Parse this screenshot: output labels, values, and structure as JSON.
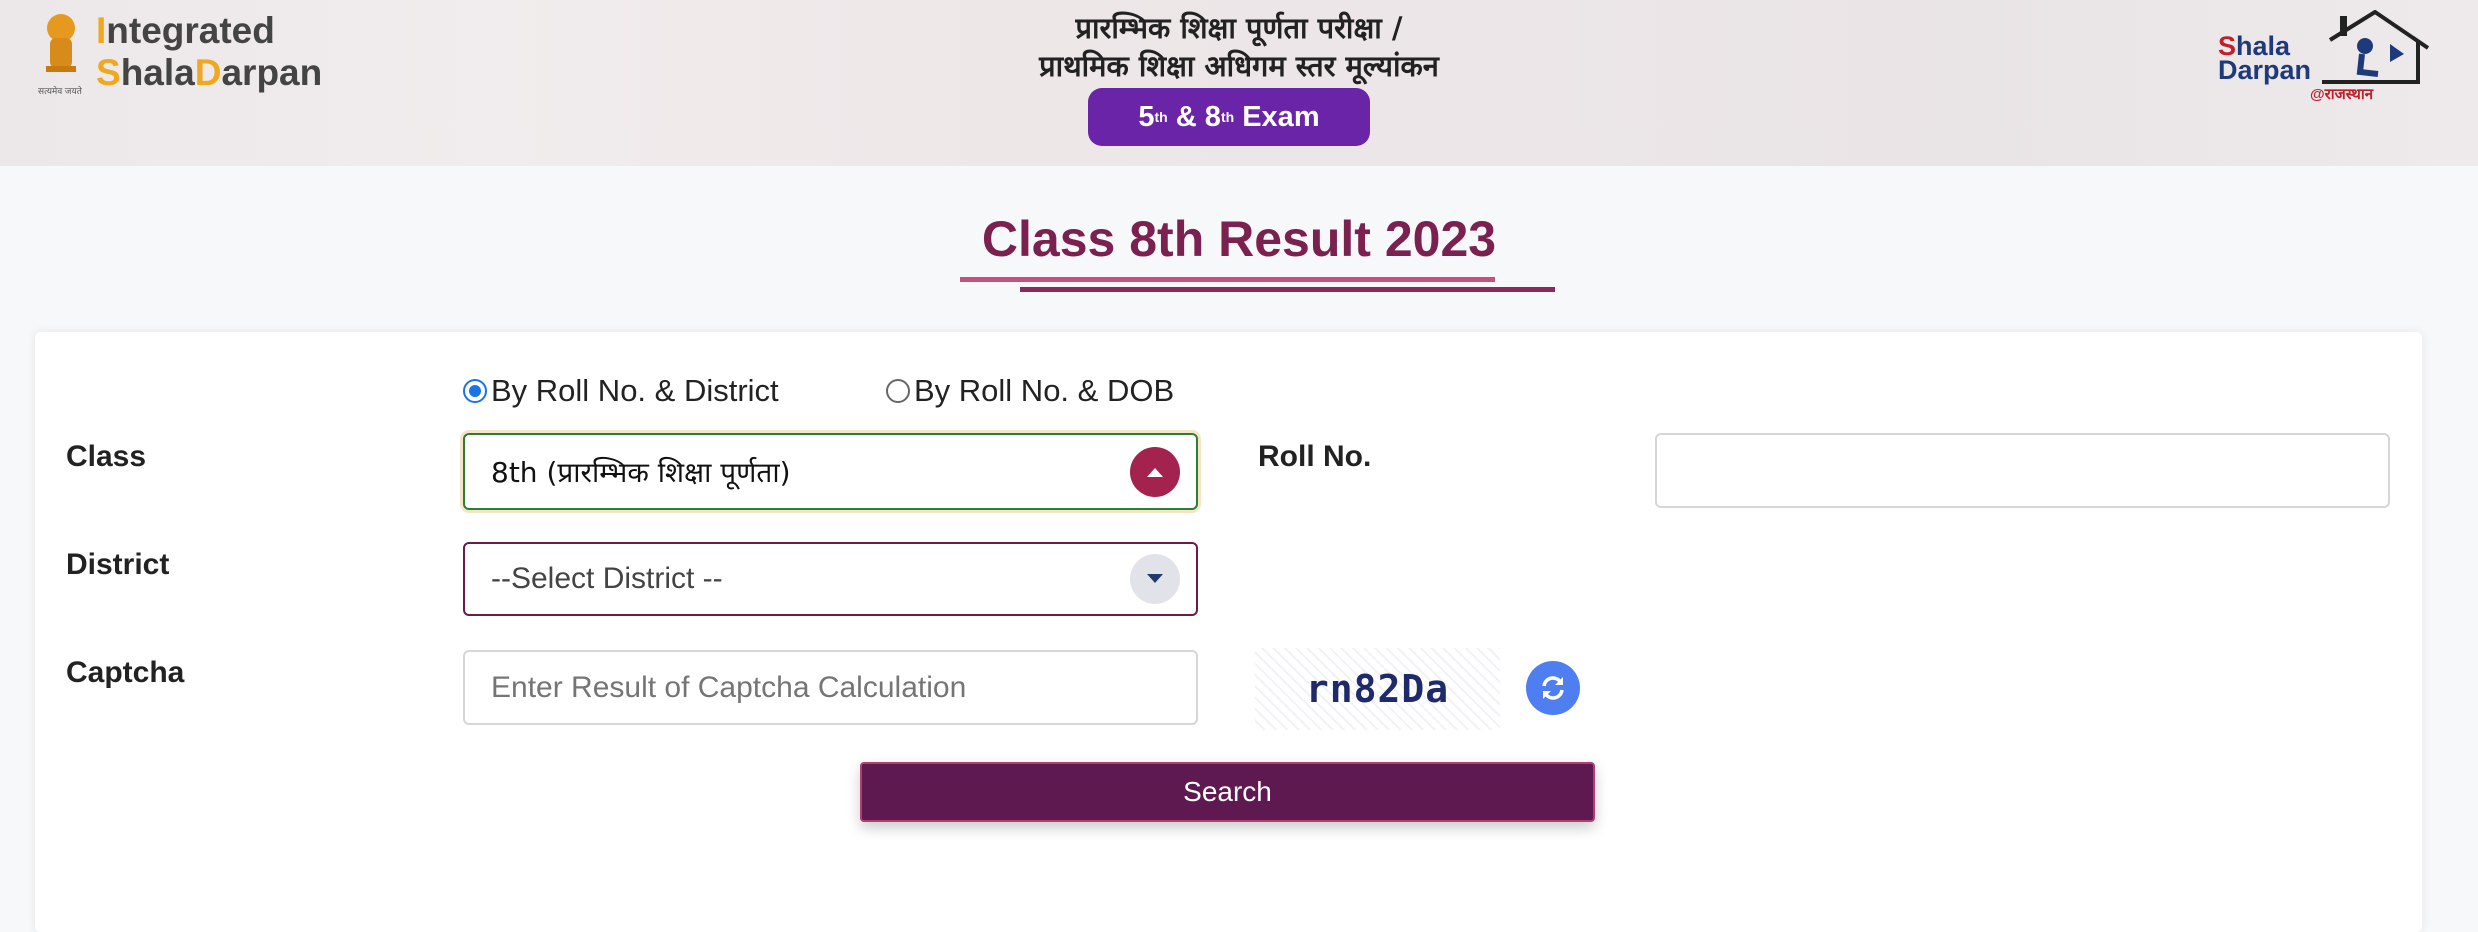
{
  "header": {
    "brand_line1": "Integrated",
    "brand_line2": "ShalaDarpan",
    "emblem_tagline": "सत्यमेव जयते",
    "hindi_line1": "प्रारम्भिक शिक्षा पूर्णता परीक्षा /",
    "hindi_line2": "प्राथमिक शिक्षा अधिगम स्तर मूल्यांकन",
    "exam_badge": {
      "n1": "5",
      "sup1": "th",
      "amp": " & ",
      "n2": "8",
      "sup2": "th",
      "word": " Exam"
    },
    "right_logo": {
      "line1": "Shala",
      "line2": "Darpan",
      "sub": "@राजस्थान"
    }
  },
  "page_title": "Class 8th Result 2023",
  "form": {
    "radio_options": [
      {
        "label": "By Roll No. & District",
        "checked": true
      },
      {
        "label": "By Roll No. & DOB",
        "checked": false
      }
    ],
    "class_label": "Class",
    "class_value": "8th (प्रारम्भिक शिक्षा पूर्णता)",
    "district_label": "District",
    "district_value": "--Select District --",
    "captcha_label": "Captcha",
    "captcha_placeholder": "Enter Result of Captcha Calculation",
    "captcha_text": "rn82Da",
    "roll_label": "Roll No.",
    "roll_value": "",
    "search_label": "Search"
  },
  "colors": {
    "title": "#7b2150",
    "button": "#5e1a50",
    "badge": "#6a24a8",
    "refresh": "#4f7ef0"
  }
}
